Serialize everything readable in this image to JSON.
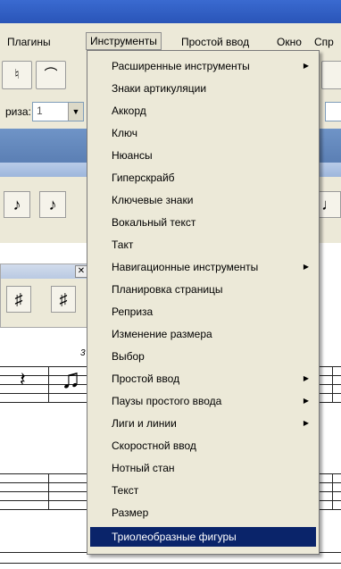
{
  "menubar": {
    "items": [
      {
        "label": "Плагины"
      },
      {
        "label": "Инструменты"
      },
      {
        "label": "Простой ввод"
      },
      {
        "label": "Окно"
      },
      {
        "label": "Спр"
      }
    ]
  },
  "toolbar": {
    "reprise_label": "риза:",
    "reprise_value": "1"
  },
  "dropdown": {
    "items": [
      {
        "label": "Расширенные инструменты",
        "submenu": true
      },
      {
        "label": "Знаки артикуляции",
        "submenu": false
      },
      {
        "label": "Аккорд",
        "submenu": false
      },
      {
        "label": "Ключ",
        "submenu": false
      },
      {
        "label": "Нюансы",
        "submenu": false
      },
      {
        "label": "Гиперскрайб",
        "submenu": false
      },
      {
        "label": "Ключевые знаки",
        "submenu": false
      },
      {
        "label": "Вокальный текст",
        "submenu": false
      },
      {
        "label": "Такт",
        "submenu": false
      },
      {
        "label": "Навигационные инструменты",
        "submenu": true
      },
      {
        "label": "Планировка страницы",
        "submenu": false
      },
      {
        "label": "Реприза",
        "submenu": false
      },
      {
        "label": "Изменение размера",
        "submenu": false
      },
      {
        "label": "Выбор",
        "submenu": false
      },
      {
        "label": "Простой ввод",
        "submenu": true
      },
      {
        "label": "Паузы простого ввода",
        "submenu": true
      },
      {
        "label": "Лиги и линии",
        "submenu": true
      },
      {
        "label": "Скоростной ввод",
        "submenu": false
      },
      {
        "label": "Нотный стан",
        "submenu": false
      },
      {
        "label": "Текст",
        "submenu": false
      },
      {
        "label": "Размер",
        "submenu": false
      },
      {
        "label": "Триолеобразные фигуры",
        "submenu": false,
        "highlighted": true
      }
    ]
  },
  "score": {
    "triplet_number": "3"
  },
  "icons": {
    "submenu_arrow": "triangle-right",
    "palette_close": "x-close"
  }
}
